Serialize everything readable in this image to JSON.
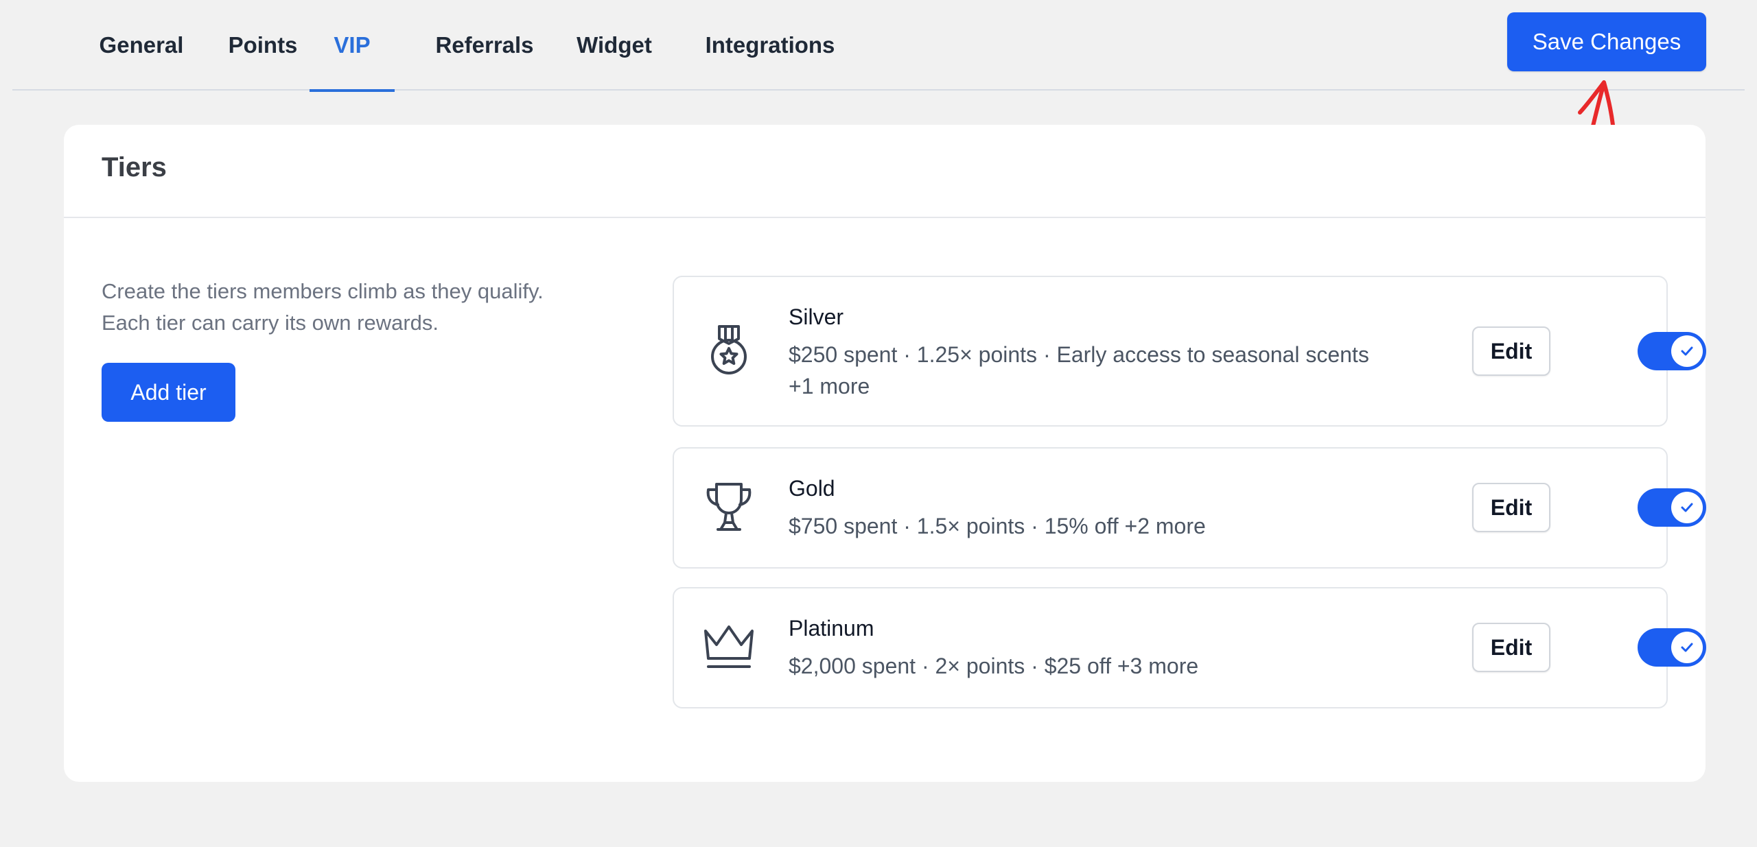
{
  "tabs": [
    {
      "label": "General",
      "active": false
    },
    {
      "label": "Points",
      "active": false
    },
    {
      "label": "VIP",
      "active": true
    },
    {
      "label": "Referrals",
      "active": false
    },
    {
      "label": "Widget",
      "active": false
    },
    {
      "label": "Integrations",
      "active": false
    }
  ],
  "toolbar": {
    "save_label": "Save Changes"
  },
  "annotation": {
    "icon": "arrow-up-icon",
    "color": "#e8292a"
  },
  "card": {
    "title": "Tiers",
    "description_line1": "Create the tiers members climb as they qualify.",
    "description_line2": "Each tier can carry its own rewards.",
    "add_label": "Add tier"
  },
  "colors": {
    "accent": "#1c5ef1",
    "active_tab": "#2a6fdb"
  },
  "tiers": [
    {
      "name": "Silver",
      "icon": "medal-icon",
      "desc_line1": "$250 spent · 1.25× points · Early access to seasonal scents",
      "desc_line2": "+1 more",
      "edit_label": "Edit",
      "enabled": true
    },
    {
      "name": "Gold",
      "icon": "trophy-icon",
      "desc_line1": "$750 spent · 1.5× points · 15% off +2 more",
      "edit_label": "Edit",
      "enabled": true
    },
    {
      "name": "Platinum",
      "icon": "crown-icon",
      "desc_line1": "$2,000 spent · 2× points · $25 off +3 more",
      "edit_label": "Edit",
      "enabled": true
    }
  ]
}
